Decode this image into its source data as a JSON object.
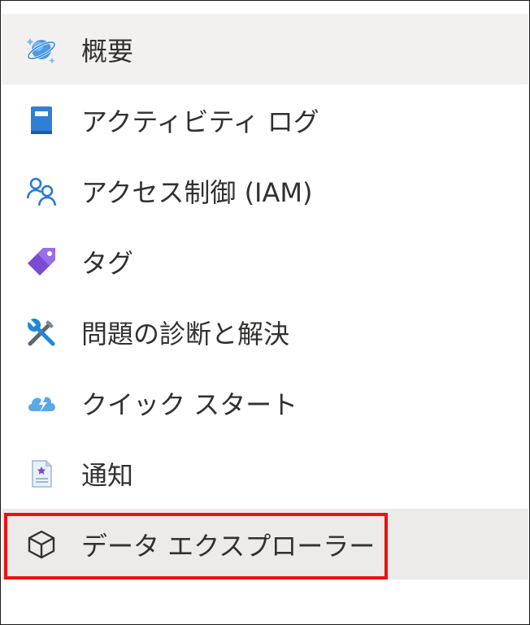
{
  "menu": {
    "items": [
      {
        "label": "概要",
        "icon": "cosmos-db-icon",
        "state": "selected"
      },
      {
        "label": "アクティビティ ログ",
        "icon": "activity-log-icon"
      },
      {
        "label": "アクセス制御 (IAM)",
        "icon": "people-icon"
      },
      {
        "label": "タグ",
        "icon": "tag-icon"
      },
      {
        "label": "問題の診断と解決",
        "icon": "wrench-screwdriver-icon"
      },
      {
        "label": "クイック スタート",
        "icon": "cloud-lightning-icon"
      },
      {
        "label": "通知",
        "icon": "notification-document-icon"
      },
      {
        "label": "データ エクスプローラー",
        "icon": "cube-icon",
        "state": "hovered"
      }
    ]
  },
  "colors": {
    "text": "#323130",
    "selected_bg": "#f2f1f0",
    "hover_bg": "#edebe9",
    "highlight_border": "#ee1111"
  }
}
